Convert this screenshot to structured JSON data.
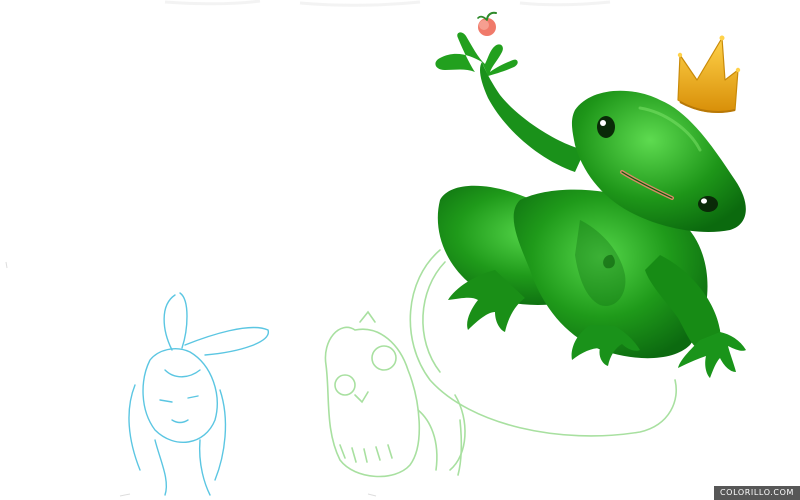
{
  "canvas": {
    "background": "#ffffff"
  },
  "watermark": {
    "text": "COLORILLO.COM"
  },
  "colors": {
    "frog_dark": "#0f7a12",
    "frog_mid": "#1f9a1a",
    "frog_light": "#3ec83a",
    "crown_gold": "#f4b614",
    "crown_shade": "#c98a08",
    "apple_red": "#f07a6a",
    "sketch_green": "#a8e0a0",
    "sketch_blue": "#5bc6e2"
  }
}
